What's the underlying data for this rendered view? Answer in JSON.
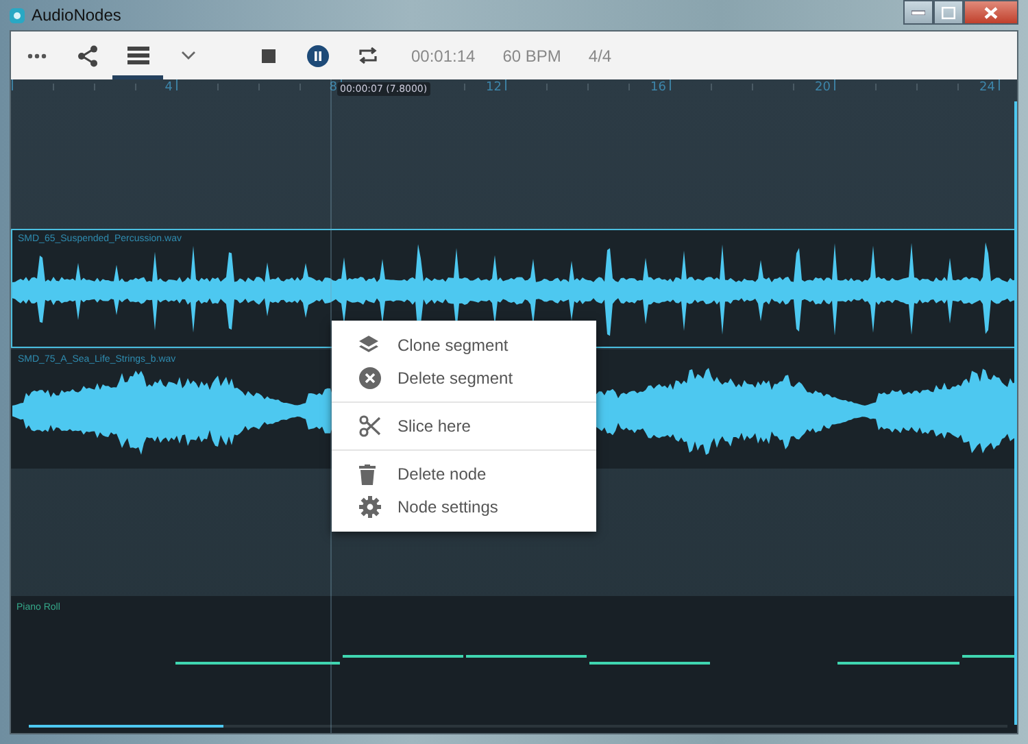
{
  "window": {
    "title": "AudioNodes"
  },
  "toolbar": {
    "view_buttons": [
      {
        "kind": "more",
        "selected": false
      },
      {
        "kind": "share",
        "selected": false
      },
      {
        "kind": "list",
        "selected": true
      },
      {
        "kind": "chevron",
        "selected": false
      }
    ],
    "playing": true,
    "time": "00:01:14",
    "tempo": "60 BPM",
    "meter": "4/4"
  },
  "ruler": {
    "labels": [
      "4",
      "8",
      "12",
      "16",
      "20",
      "24"
    ],
    "playhead_tooltip": "00:00:07 (7.8000)"
  },
  "tracks": [
    {
      "kind": "percussion",
      "name": "SMD_65_Suspended_Percussion.wav",
      "selected": true
    },
    {
      "kind": "strings",
      "name": "SMD_75_A_Sea_Life_Strings_b.wav",
      "selected": false
    }
  ],
  "piano_roll": {
    "title": "Piano Roll"
  },
  "context_menu": {
    "groups": [
      [
        {
          "kind": "clone",
          "label": "Clone segment"
        },
        {
          "kind": "delete-segment",
          "label": "Delete segment"
        }
      ],
      [
        {
          "kind": "slice",
          "label": "Slice here"
        }
      ],
      [
        {
          "kind": "delete-node",
          "label": "Delete node"
        },
        {
          "kind": "settings",
          "label": "Node settings"
        }
      ]
    ]
  }
}
